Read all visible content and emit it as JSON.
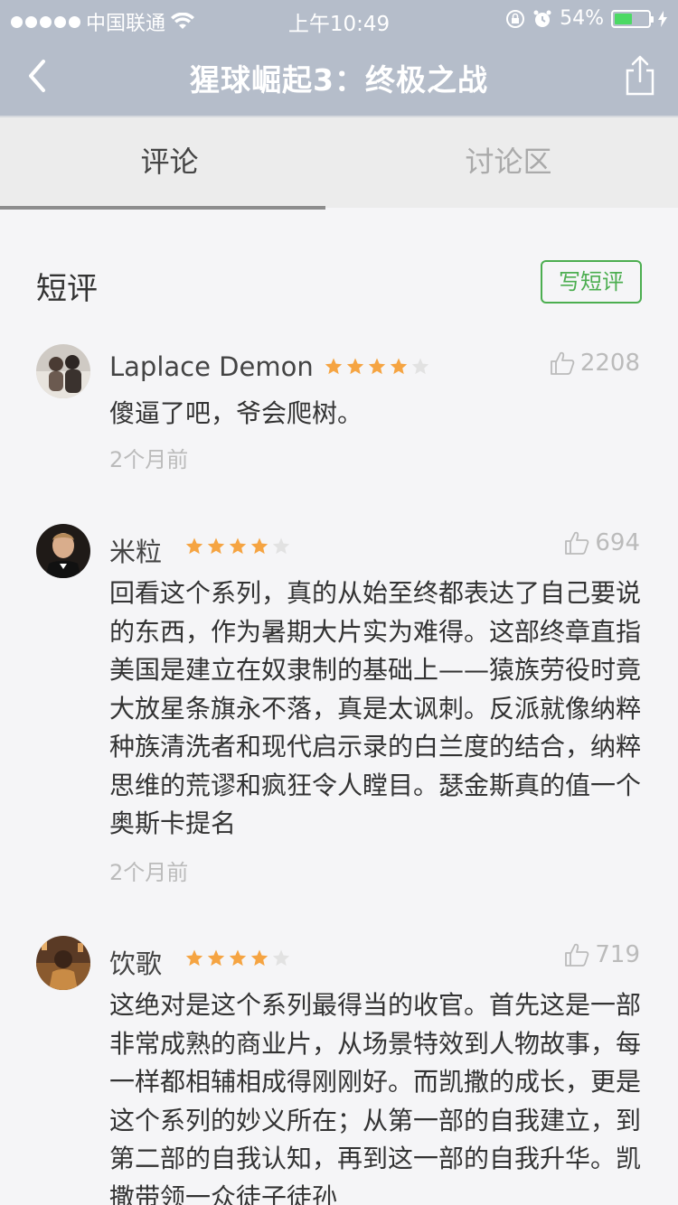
{
  "status": {
    "carrier": "中国联通",
    "time": "上午10:49",
    "battery": "54%",
    "battery_level": 0.54
  },
  "nav": {
    "title": "猩球崛起3：终极之战"
  },
  "tabs": [
    {
      "label": "评论"
    },
    {
      "label": "讨论区"
    }
  ],
  "section": {
    "title": "短评",
    "write_label": "写短评"
  },
  "reviews": [
    {
      "name": "Laplace Demon",
      "rating": 4,
      "likes": "2208",
      "text": "傻逼了吧，爷会爬树。",
      "time": "2个月前"
    },
    {
      "name": "米粒",
      "rating": 4,
      "likes": "694",
      "text": "回看这个系列，真的从始至终都表达了自己要说的东西，作为暑期大片实为难得。这部终章直指美国是建立在奴隶制的基础上——猿族劳役时竟大放星条旗永不落，真是太讽刺。反派就像纳粹种族清洗者和现代启示录的白兰度的结合，纳粹思维的荒谬和疯狂令人瞠目。瑟金斯真的值一个奥斯卡提名",
      "time": "2个月前"
    },
    {
      "name": "饮歌",
      "rating": 4,
      "likes": "719",
      "text": "这绝对是这个系列最得当的收官。首先这是一部非常成熟的商业片，从场景特效到人物故事，每一样都相辅相成得刚刚好。而凯撒的成长，更是这个系列的妙义所在；从第一部的自我建立，到第二部的自我认知，再到这一部的自我升华。凯撒带领一众徒子徒孙",
      "time": ""
    }
  ],
  "colors": {
    "header_bg": "#b5bdca",
    "accent_green": "#4cae50",
    "star": "#f5a442",
    "star_empty": "#e2e2e2"
  }
}
